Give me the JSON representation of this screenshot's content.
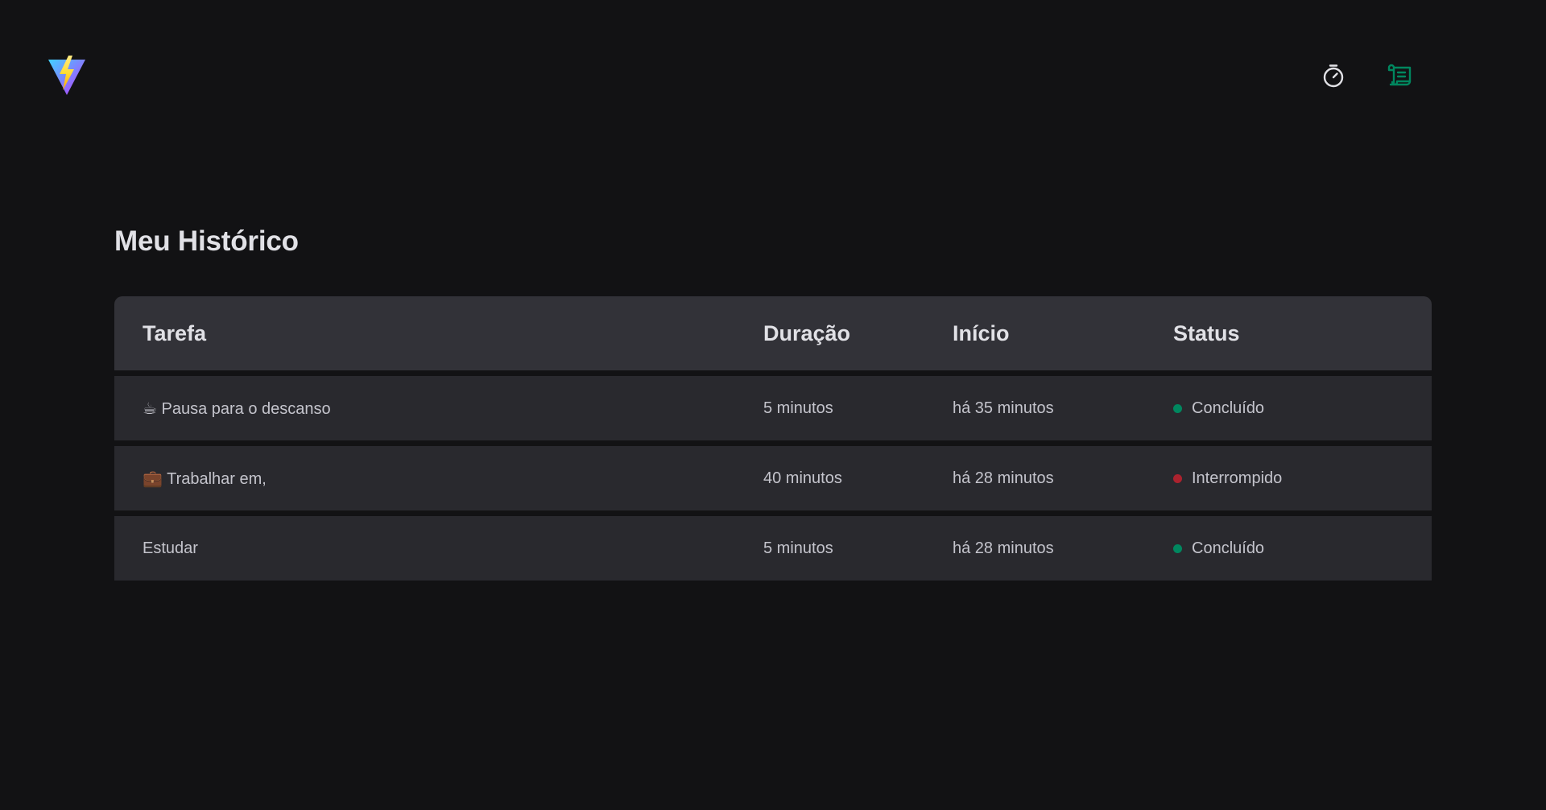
{
  "header": {
    "logo_name": "vite-logo",
    "nav": [
      {
        "name": "timer",
        "icon": "timer-icon",
        "color": "#e1e1e6"
      },
      {
        "name": "history",
        "icon": "scroll-icon",
        "color": "#00875f"
      }
    ]
  },
  "history": {
    "title": "Meu Histórico",
    "columns": [
      "Tarefa",
      "Duração",
      "Início",
      "Status"
    ],
    "rows": [
      {
        "task": "☕ Pausa para o descanso",
        "duration": "5 minutos",
        "start": "há 35 minutos",
        "status": "Concluído",
        "status_color": "#00875f"
      },
      {
        "task": "💼 Trabalhar em,",
        "duration": "40 minutos",
        "start": "há 28 minutos",
        "status": "Interrompido",
        "status_color": "#ab222e"
      },
      {
        "task": "Estudar",
        "duration": "5 minutos",
        "start": "há 28 minutos",
        "status": "Concluído",
        "status_color": "#00875f"
      }
    ]
  },
  "colors": {
    "background": "#121214",
    "header_row": "#323238",
    "body_row": "#29292e",
    "accent": "#00875f",
    "danger": "#ab222e"
  }
}
